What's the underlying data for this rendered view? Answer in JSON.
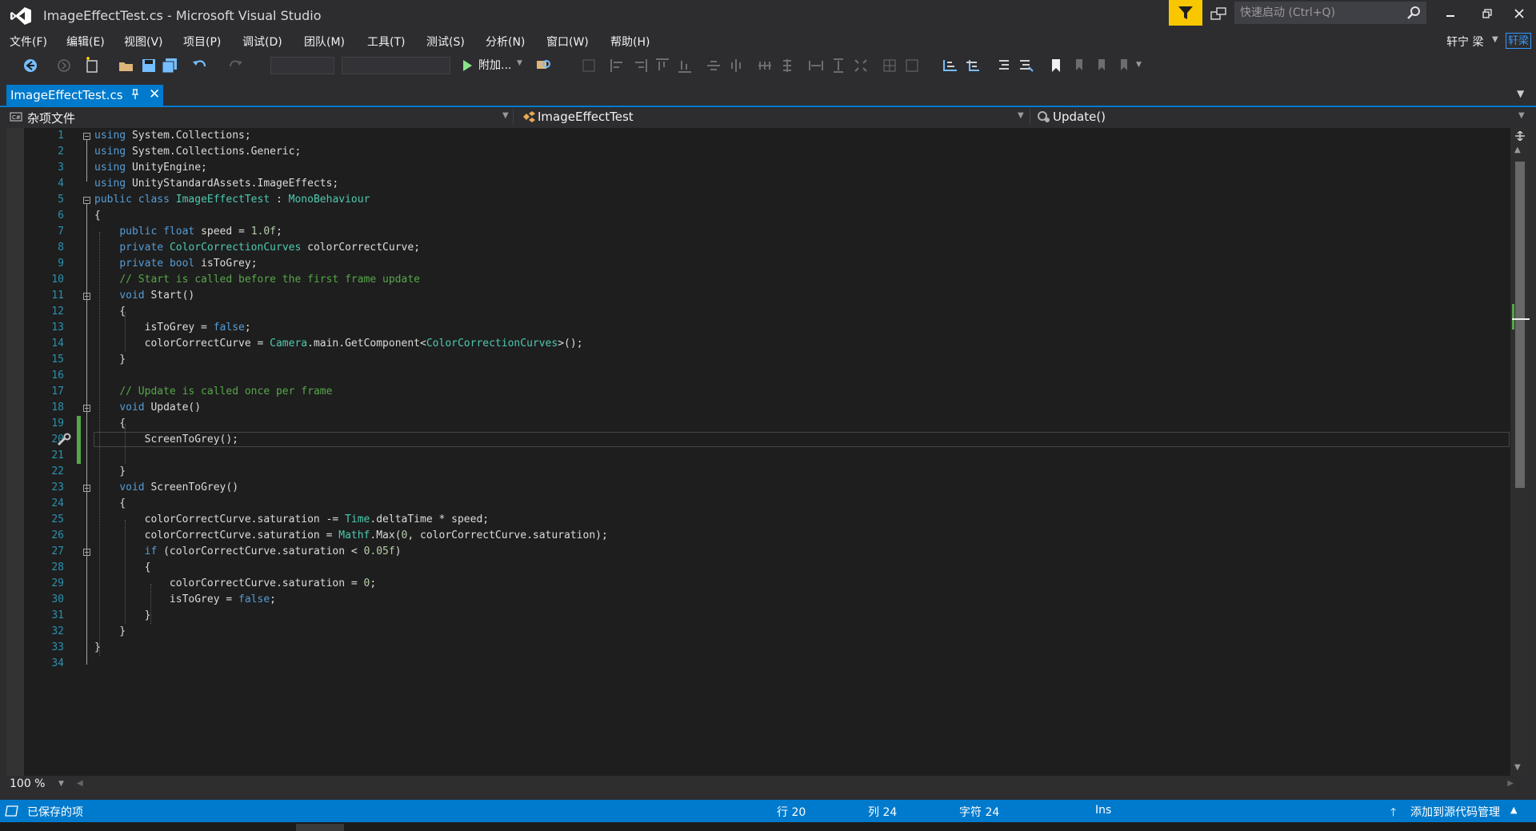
{
  "window": {
    "title": "ImageEffectTest.cs - Microsoft Visual Studio",
    "quick_launch_placeholder": "快速启动 (Ctrl+Q)",
    "user_name": "轩宁 梁",
    "user_avatar": "轩梁"
  },
  "menu": [
    "文件(F)",
    "编辑(E)",
    "视图(V)",
    "项目(P)",
    "调试(D)",
    "团队(M)",
    "工具(T)",
    "测试(S)",
    "分析(N)",
    "窗口(W)",
    "帮助(H)"
  ],
  "toolbar": {
    "run_label": "附加..."
  },
  "tab": {
    "label": "ImageEffectTest.cs"
  },
  "navbar": {
    "project": "杂项文件",
    "type": "ImageEffectTest",
    "member": "Update()"
  },
  "editor": {
    "line_numbers": [
      "1",
      "2",
      "3",
      "4",
      "5",
      "6",
      "7",
      "8",
      "9",
      "10",
      "11",
      "12",
      "13",
      "14",
      "15",
      "16",
      "17",
      "18",
      "19",
      "20",
      "21",
      "22",
      "23",
      "24",
      "25",
      "26",
      "27",
      "28",
      "29",
      "30",
      "31",
      "32",
      "33",
      "34"
    ],
    "lines": [
      "using System.Collections;",
      "using System.Collections.Generic;",
      "using UnityEngine;",
      "using UnityStandardAssets.ImageEffects;",
      "public class ImageEffectTest : MonoBehaviour",
      "{",
      "    public float speed = 1.0f;",
      "    private ColorCorrectionCurves colorCorrectCurve;",
      "    private bool isToGrey;",
      "    // Start is called before the first frame update",
      "    void Start()",
      "    {",
      "        isToGrey = false;",
      "        colorCorrectCurve = Camera.main.GetComponent<ColorCorrectionCurves>();",
      "    }",
      "",
      "    // Update is called once per frame",
      "    void Update()",
      "    {",
      "        ScreenToGrey();",
      "",
      "    }",
      "    void ScreenToGrey()",
      "    {",
      "        colorCorrectCurve.saturation -= Time.deltaTime * speed;",
      "        colorCorrectCurve.saturation = Mathf.Max(0, colorCorrectCurve.saturation);",
      "        if (colorCorrectCurve.saturation < 0.05f)",
      "        {",
      "            colorCorrectCurve.saturation = 0;",
      "            isToGrey = false;",
      "        }",
      "    }",
      "}",
      ""
    ]
  },
  "zoom": "100 %",
  "status": {
    "message": "已保存的项",
    "line": "行 20",
    "column": "列 24",
    "char": "字符 24",
    "mode": "Ins",
    "source_control": "添加到源代码管理"
  },
  "colors": {
    "accent": "#007acc",
    "keyword": "#569cd6",
    "type": "#4ec9b0",
    "comment": "#57a64a",
    "number": "#b5cea8",
    "line_number": "#2b91af",
    "notification": "#f9c700"
  }
}
